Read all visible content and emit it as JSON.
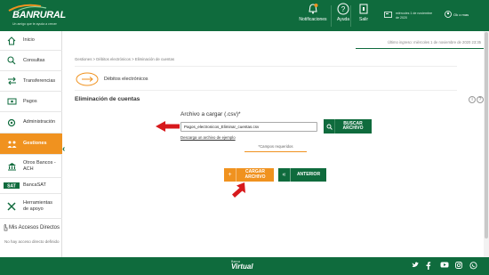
{
  "header": {
    "logo_text": "BANRURAL",
    "logo_tagline": "Un amigo que te ayuda a crecer",
    "notifications_label": "Notificaciones",
    "help_label": "Ayuda",
    "exit_label": "Salir",
    "session_date": "miércoles 1 de noviembre de 2020",
    "user_text": "Ok o mas"
  },
  "sidebar": {
    "items": [
      {
        "label": "Inicio",
        "icon": "home-icon"
      },
      {
        "label": "Consultas",
        "icon": "search-icon"
      },
      {
        "label": "Transferencias",
        "icon": "transfer-icon"
      },
      {
        "label": "Pagos",
        "icon": "payment-icon"
      },
      {
        "label": "Administración",
        "icon": "admin-icon"
      },
      {
        "label": "Gestiones",
        "icon": "management-icon"
      },
      {
        "label": "Otros Bancos - ACH",
        "icon": "bank-icon"
      },
      {
        "label": "BancaSAT",
        "icon": "sat-logo-icon"
      },
      {
        "label": "Herramientas de apoyo",
        "icon": "tools-icon"
      }
    ],
    "accesos_title": "Mis Accesos Directos",
    "accesos_empty": "No hay acceso directo definido"
  },
  "main": {
    "last_login": "Último ingreso: miércoles 1 de noviembre de 2020 23:35",
    "breadcrumb": "Gestiones > Débitos electrónicos > Eliminación de cuentas",
    "section_title": "Débitos electrónicos",
    "page_heading": "Eliminación de cuentas",
    "file_label": "Archivo a cargar (.csv)*",
    "file_value": "Pagos_electronicos_Eliminar_cuentas.csv",
    "search_button": "BUSCAR ARCHIVO",
    "example_link": "Descarga un archivo de ejemplo",
    "required_note": "*Campos requeridos",
    "load_button": "CARGAR ARCHIVO",
    "back_button": "ANTERIOR"
  },
  "footer": {
    "logo_small": "Banca",
    "logo_big": "Virtual"
  },
  "colors": {
    "brand_green": "#0f6b3d",
    "accent_orange": "#f0921f",
    "arrow_red": "#d7191c"
  }
}
